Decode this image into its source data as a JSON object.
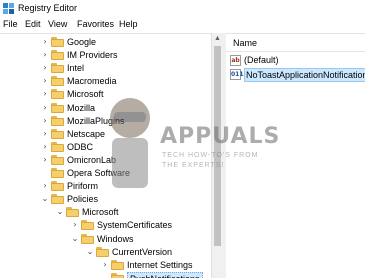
{
  "window": {
    "title": "Registry Editor",
    "icon": "registry-editor-icon"
  },
  "menu": [
    "File",
    "Edit",
    "View",
    "Favorites",
    "Help"
  ],
  "tree": {
    "items": [
      {
        "label": "Google",
        "expander": "›",
        "depth": 0
      },
      {
        "label": "IM Providers",
        "expander": "›",
        "depth": 0
      },
      {
        "label": "Intel",
        "expander": "›",
        "depth": 0
      },
      {
        "label": "Macromedia",
        "expander": "›",
        "depth": 0
      },
      {
        "label": "Microsoft",
        "expander": "›",
        "depth": 0
      },
      {
        "label": "Mozilla",
        "expander": "›",
        "depth": 0
      },
      {
        "label": "MozillaPlugins",
        "expander": "›",
        "depth": 0
      },
      {
        "label": "Netscape",
        "expander": "›",
        "depth": 0
      },
      {
        "label": "ODBC",
        "expander": "›",
        "depth": 0
      },
      {
        "label": "OmicronLab",
        "expander": "›",
        "depth": 0
      },
      {
        "label": "Opera Software",
        "expander": "",
        "depth": 0
      },
      {
        "label": "Piriform",
        "expander": "›",
        "depth": 0
      },
      {
        "label": "Policies",
        "expander": "⌄",
        "depth": 0
      },
      {
        "label": "Microsoft",
        "expander": "⌄",
        "depth": 1
      },
      {
        "label": "SystemCertificates",
        "expander": "›",
        "depth": 2
      },
      {
        "label": "Windows",
        "expander": "⌄",
        "depth": 2
      },
      {
        "label": "CurrentVersion",
        "expander": "⌄",
        "depth": 3
      },
      {
        "label": "Internet Settings",
        "expander": "›",
        "depth": 4
      },
      {
        "label": "PushNotifications",
        "expander": "",
        "depth": 4,
        "selected": true
      }
    ]
  },
  "list": {
    "column_name": "Name",
    "values": [
      {
        "name": "(Default)",
        "icon": "string-value-icon",
        "icon_glyph": "ab"
      },
      {
        "name": "NoToastApplicationNotification",
        "icon": "binary-value-icon",
        "icon_glyph": "011",
        "selected": true
      }
    ]
  },
  "watermark": {
    "title": "APPUALS",
    "line1": "TECH HOW-TO'S FROM",
    "line2": "THE EXPERTS!"
  },
  "colors": {
    "selection": "#cce8ff",
    "folder": "#f4cf6b"
  }
}
